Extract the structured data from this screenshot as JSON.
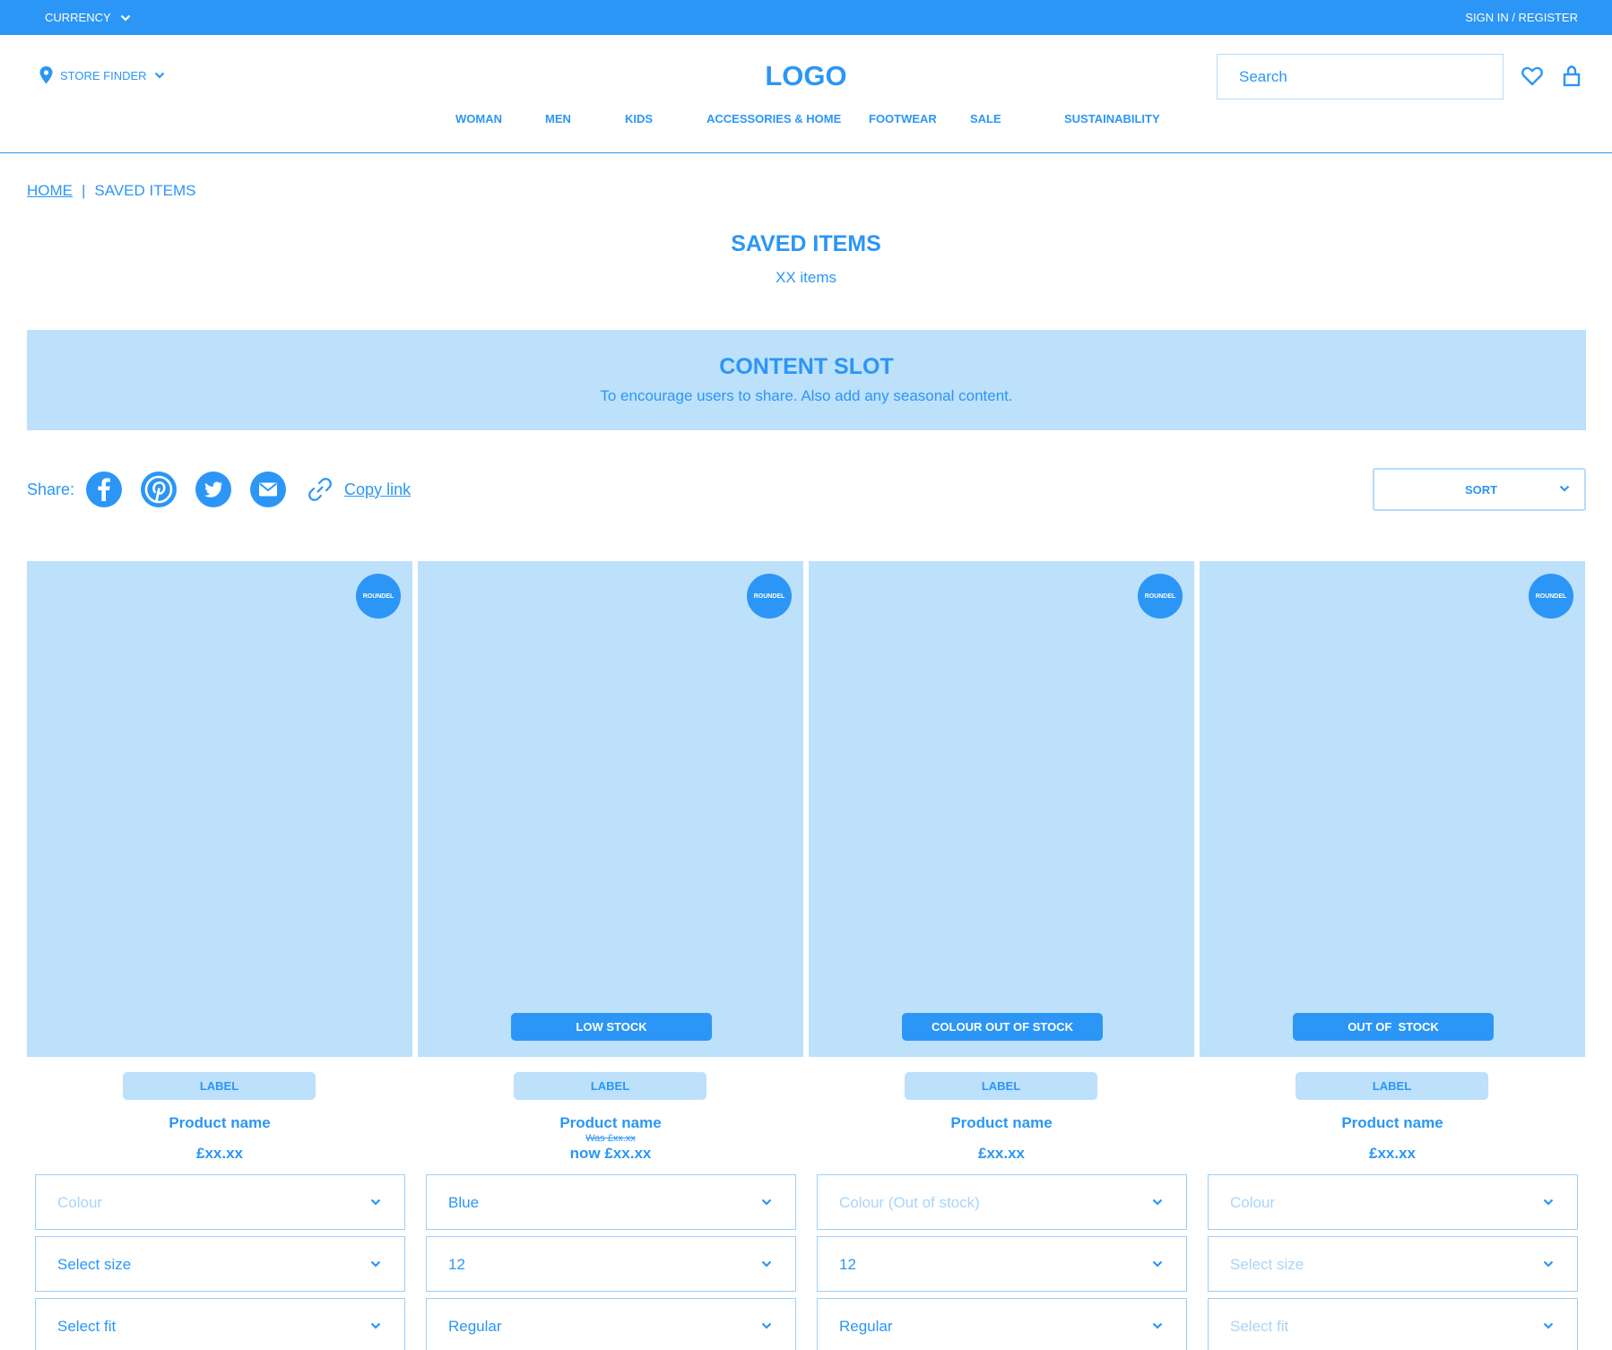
{
  "topbar": {
    "currency_label": "CURRENCY",
    "signin_label": "SIGN IN / REGISTER"
  },
  "header": {
    "store_finder_label": "STORE FINDER",
    "logo": "LOGO",
    "search_placeholder": "Search",
    "nav": [
      "WOMAN",
      "MEN",
      "KIDS",
      "ACCESSORIES & HOME",
      "FOOTWEAR",
      "SALE",
      "SUSTAINABILITY"
    ]
  },
  "breadcrumb": {
    "home": "HOME",
    "separator": "|",
    "current": "SAVED ITEMS"
  },
  "page": {
    "title": "SAVED ITEMS",
    "item_count": "XX items"
  },
  "content_slot": {
    "title": "CONTENT SLOT",
    "text": "To encourage users to share. Also add any seasonal content."
  },
  "share": {
    "label": "Share:",
    "icons": [
      "facebook-icon",
      "pinterest-icon",
      "twitter-icon",
      "email-icon",
      "link-icon"
    ],
    "copy_link": "Copy link"
  },
  "sort": {
    "label": "SORT"
  },
  "colors": {
    "accent": "#2b96f5",
    "light": "#bde0fb",
    "border": "#9ccff8",
    "muted_text": "#a9d4f9"
  },
  "products": [
    {
      "roundel": "ROUNDEL",
      "stock_badge": "",
      "label": "LABEL",
      "name": "Product name",
      "was_price": "",
      "price": "£xx.xx",
      "colour": {
        "value": "Colour",
        "placeholder": true
      },
      "size": {
        "value": "Select size",
        "placeholder": false
      },
      "fit": {
        "value": "Select fit",
        "placeholder": false
      }
    },
    {
      "roundel": "ROUNDEL",
      "stock_badge": "LOW STOCK",
      "label": "LABEL",
      "name": "Product name",
      "was_price": "Was £xx.xx",
      "price": "now £xx.xx",
      "colour": {
        "value": "Blue",
        "placeholder": false
      },
      "size": {
        "value": "12",
        "placeholder": false
      },
      "fit": {
        "value": "Regular",
        "placeholder": false
      }
    },
    {
      "roundel": "ROUNDEL",
      "stock_badge": "COLOUR OUT OF STOCK",
      "label": "LABEL",
      "name": "Product name",
      "was_price": "",
      "price": "£xx.xx",
      "colour": {
        "value": "Colour (Out of stock)",
        "placeholder": true
      },
      "size": {
        "value": "12",
        "placeholder": false
      },
      "fit": {
        "value": "Regular",
        "placeholder": false
      }
    },
    {
      "roundel": "ROUNDEL",
      "stock_badge": "OUT OF  STOCK",
      "label": "LABEL",
      "name": "Product name",
      "was_price": "",
      "price": "£xx.xx",
      "colour": {
        "value": "Colour",
        "placeholder": true
      },
      "size": {
        "value": "Select size",
        "placeholder": true
      },
      "fit": {
        "value": "Select fit",
        "placeholder": true
      }
    }
  ]
}
